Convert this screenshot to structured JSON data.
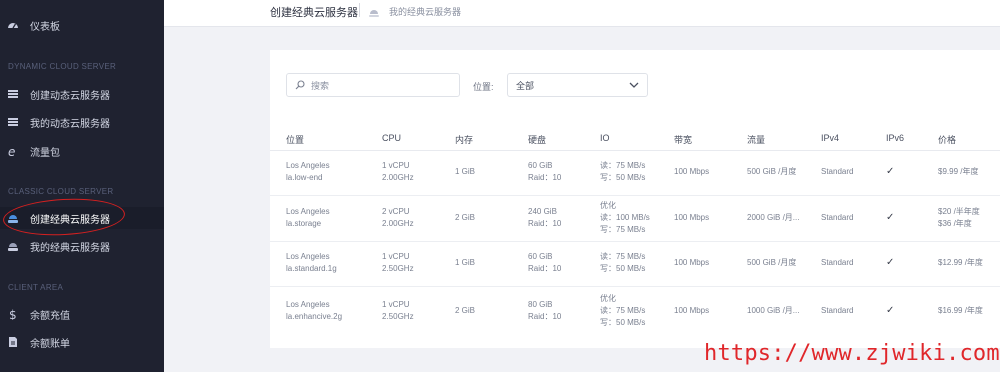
{
  "sidebar": {
    "dashboard": "仪表板",
    "section_dynamic": "DYNAMIC CLOUD SERVER",
    "create_dynamic": "创建动态云服务器",
    "my_dynamic": "我的动态云服务器",
    "traffic_pack": "流量包",
    "section_classic": "CLASSIC CLOUD SERVER",
    "create_classic": "创建经典云服务器",
    "my_classic": "我的经典云服务器",
    "section_client": "CLIENT AREA",
    "balance_topup": "余额充值",
    "balance_bill": "余额账单"
  },
  "header": {
    "title": "创建经典云服务器",
    "breadcrumb": "我的经典云服务器"
  },
  "filters": {
    "search_placeholder": "搜索",
    "location_label": "位置:",
    "location_value": "全部"
  },
  "table": {
    "headers": [
      "位置",
      "CPU",
      "内存",
      "硬盘",
      "IO",
      "带宽",
      "流量",
      "IPv4",
      "IPv6",
      "价格"
    ],
    "rows": [
      {
        "loc1": "Los Angeles",
        "loc2": "la.low-end",
        "cpu1": "1 vCPU",
        "cpu2": "2.00GHz",
        "mem": "1 GiB",
        "disk1": "60 GiB",
        "disk2": "Raid：10",
        "io0": "",
        "io1": "读：75 MB/s",
        "io2": "写：50 MB/s",
        "bw": "100 Mbps",
        "traffic": "500 GiB /月度",
        "ipv4": "Standard",
        "ipv6": "✓",
        "price1": "$9.99 /年度",
        "price2": ""
      },
      {
        "loc1": "Los Angeles",
        "loc2": "la.storage",
        "cpu1": "2 vCPU",
        "cpu2": "2.00GHz",
        "mem": "2 GiB",
        "disk1": "240 GiB",
        "disk2": "Raid：10",
        "io0": "优化",
        "io1": "读：100 MB/s",
        "io2": "写：75 MB/s",
        "bw": "100 Mbps",
        "traffic": "2000 GiB /月...",
        "ipv4": "Standard",
        "ipv6": "✓",
        "price1": "$20 /半年度",
        "price2": "$36 /年度"
      },
      {
        "loc1": "Los Angeles",
        "loc2": "la.standard.1g",
        "cpu1": "1 vCPU",
        "cpu2": "2.50GHz",
        "mem": "1 GiB",
        "disk1": "60 GiB",
        "disk2": "Raid：10",
        "io0": "",
        "io1": "读：75 MB/s",
        "io2": "写：50 MB/s",
        "bw": "100 Mbps",
        "traffic": "500 GiB /月度",
        "ipv4": "Standard",
        "ipv6": "✓",
        "price1": "$12.99 /年度",
        "price2": ""
      },
      {
        "loc1": "Los Angeles",
        "loc2": "la.enhancive.2g",
        "cpu1": "1 vCPU",
        "cpu2": "2.50GHz",
        "mem": "2 GiB",
        "disk1": "80 GiB",
        "disk2": "Raid：10",
        "io0": "优化",
        "io1": "读：75 MB/s",
        "io2": "写：50 MB/s",
        "bw": "100 Mbps",
        "traffic": "1000 GiB /月...",
        "ipv4": "Standard",
        "ipv6": "✓",
        "price1": "$16.99 /年度",
        "price2": ""
      }
    ]
  },
  "watermark": "https://www.zjwiki.com",
  "colors": {
    "sidebar_bg": "#1f2230",
    "annotation_red": "#d42020",
    "watermark_red": "#e0262a"
  }
}
